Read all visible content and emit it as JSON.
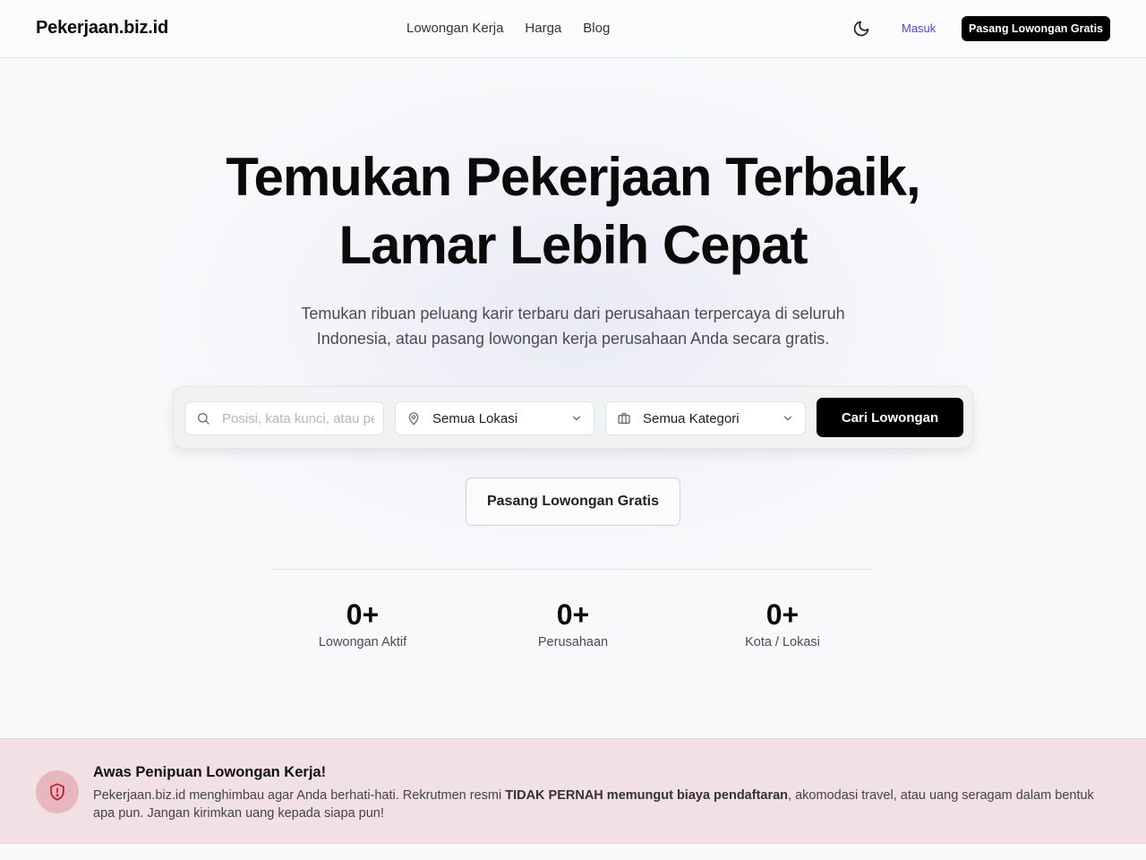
{
  "header": {
    "logo": "Pekerjaan.biz.id",
    "nav": [
      "Lowongan Kerja",
      "Harga",
      "Blog"
    ],
    "theme_icon": "moon-icon",
    "login": "Masuk",
    "cta": "Pasang Lowongan Gratis"
  },
  "hero": {
    "title_line1": "Temukan Pekerjaan Terbaik,",
    "title_line2": "Lamar Lebih Cepat",
    "subtitle_line1": "Temukan ribuan peluang karir terbaru dari perusahaan terpercaya di seluruh",
    "subtitle_line2": "Indonesia, atau pasang lowongan kerja perusahaan Anda secara gratis."
  },
  "search": {
    "keyword_placeholder": "Posisi, kata kunci, atau perusahaan",
    "keyword_value": "",
    "location": "Semua Lokasi",
    "category": "Semua Kategori",
    "button": "Cari Lowongan"
  },
  "post_button": "Pasang Lowongan Gratis",
  "stats": [
    {
      "value": "0+",
      "label": "Lowongan Aktif"
    },
    {
      "value": "0+",
      "label": "Perusahaan"
    },
    {
      "value": "0+",
      "label": "Kota / Lokasi"
    }
  ],
  "warning": {
    "title": "Awas Penipuan Lowongan Kerja!",
    "text_before": "Pekerjaan.biz.id menghimbau agar Anda berhati-hati. Rekrutmen resmi ",
    "text_bold": "TIDAK PERNAH memungut biaya pendaftaran",
    "text_after": ", akomodasi travel, atau uang seragam dalam bentuk apa pun. Jangan kirimkan uang kepada siapa pun!",
    "icon": "shield-alert-icon"
  },
  "colors": {
    "accent_link": "#4f46e5",
    "primary_button": "#000000",
    "warning_bg": "#f2e1e4",
    "warning_icon": "#c0252f"
  }
}
